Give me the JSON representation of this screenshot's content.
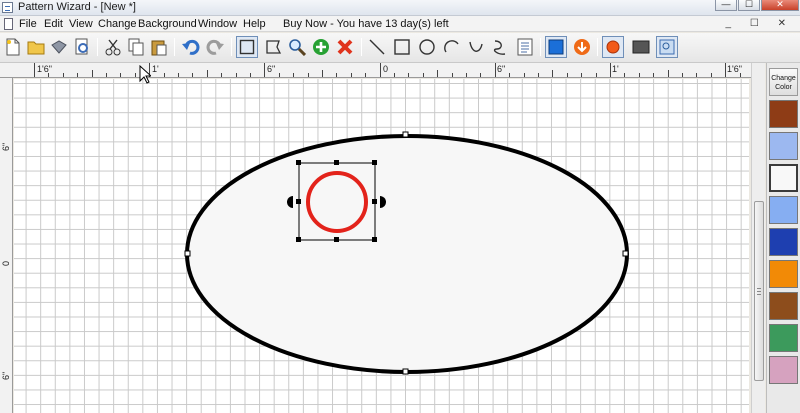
{
  "window": {
    "title": "Pattern Wizard - [New *]",
    "min_glyph": "—",
    "max_glyph": "☐",
    "close_glyph": "✕"
  },
  "menu": {
    "items": [
      "File",
      "Edit",
      "View",
      "Change",
      "Background",
      "Window",
      "Help"
    ],
    "trial_notice": "Buy Now - You have 13 day(s) left",
    "mdi_controls": "_ ☐ ✕"
  },
  "toolbar": {
    "icons": [
      "new-icon",
      "open-icon",
      "save-icon",
      "print-preview-icon",
      "cut-icon",
      "copy-icon",
      "paste-icon",
      "undo-icon",
      "redo-icon",
      "select-icon",
      "lasso-icon",
      "zoom-icon",
      "add-icon",
      "delete-icon",
      "line-icon",
      "rectangle-icon",
      "ellipse-icon",
      "arc-icon",
      "curve-icon",
      "freehand-icon",
      "properties-icon",
      "fill-color-icon",
      "download-icon",
      "record-icon",
      "background-icon",
      "fit-icon"
    ]
  },
  "ruler": {
    "top_labels": [
      "1'6\"",
      "1'",
      "6\"",
      "0",
      "6\"",
      "1'",
      "1'6\""
    ],
    "left_labels": [
      "6\"",
      "0",
      "6\""
    ]
  },
  "palette": {
    "change_color_label": "Change Color",
    "swatches": [
      {
        "name": "rust-brown",
        "color": "#8e3c16"
      },
      {
        "name": "light-blue",
        "color": "#9cb8f0"
      },
      {
        "name": "white",
        "color": "#f8f8f8"
      },
      {
        "name": "sky-blue",
        "color": "#86aef2"
      },
      {
        "name": "cobalt-blue",
        "color": "#1e3fb0"
      },
      {
        "name": "orange",
        "color": "#f28a06"
      },
      {
        "name": "amber-brown",
        "color": "#8d4d1c"
      },
      {
        "name": "green",
        "color": "#3c9a5c"
      },
      {
        "name": "pink",
        "color": "#d6a2bf"
      }
    ]
  },
  "canvas": {
    "ellipse_fill": "#f7f7f7",
    "ellipse_stroke": "#000000",
    "circle_stroke": "#e3231b"
  }
}
